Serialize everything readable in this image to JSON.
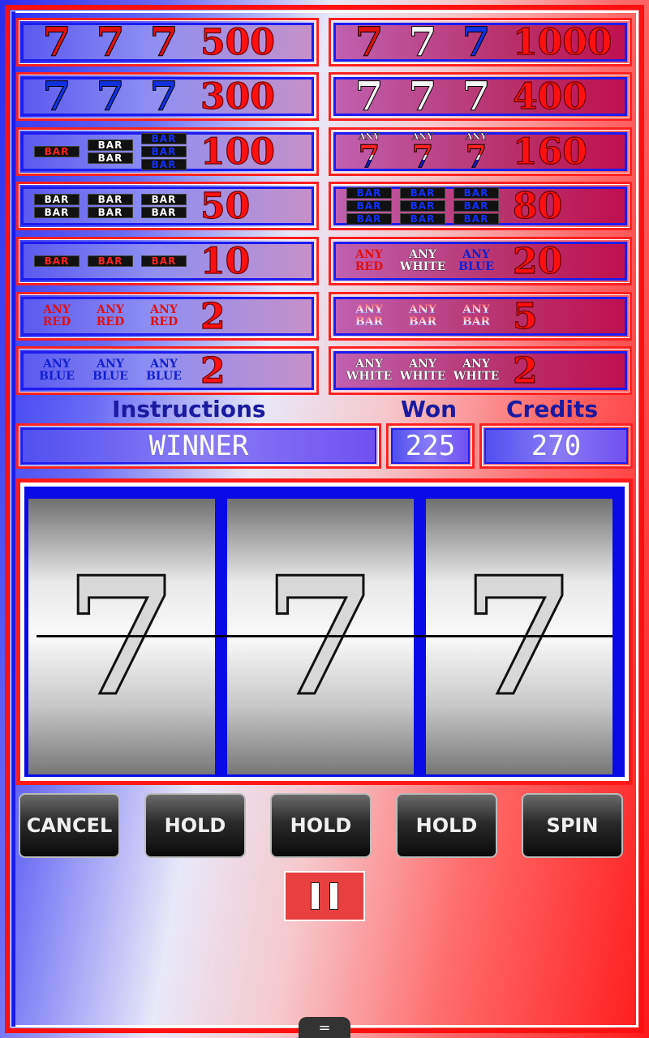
{
  "paytable": {
    "left": [
      {
        "symbols": [
          "seven-red",
          "seven-red",
          "seven-red"
        ],
        "payout": "500"
      },
      {
        "symbols": [
          "seven-blue",
          "seven-blue",
          "seven-blue"
        ],
        "payout": "300"
      },
      {
        "symbols": [
          "bar1-red",
          "bar2-white",
          "bar3-blue"
        ],
        "payout": "100"
      },
      {
        "symbols": [
          "bar2-white",
          "bar2-white",
          "bar2-white"
        ],
        "payout": "50"
      },
      {
        "symbols": [
          "bar1-red",
          "bar1-red",
          "bar1-red"
        ],
        "payout": "10"
      },
      {
        "symbols": [
          "any-red",
          "any-red",
          "any-red"
        ],
        "payout": "2"
      },
      {
        "symbols": [
          "any-blue",
          "any-blue",
          "any-blue"
        ],
        "payout": "2"
      }
    ],
    "right": [
      {
        "symbols": [
          "seven-red",
          "seven-white",
          "seven-blue"
        ],
        "payout": "1000"
      },
      {
        "symbols": [
          "seven-white",
          "seven-white",
          "seven-white"
        ],
        "payout": "400"
      },
      {
        "symbols": [
          "any-seven",
          "any-seven",
          "any-seven"
        ],
        "payout": "160"
      },
      {
        "symbols": [
          "bar3-blue",
          "bar3-blue",
          "bar3-blue"
        ],
        "payout": "80"
      },
      {
        "symbols": [
          "any-red",
          "any-white",
          "any-blue"
        ],
        "payout": "20"
      },
      {
        "symbols": [
          "any-bar",
          "any-bar",
          "any-bar"
        ],
        "payout": "5"
      },
      {
        "symbols": [
          "any-white",
          "any-white",
          "any-white"
        ],
        "payout": "2"
      }
    ],
    "text": {
      "bar": "BAR",
      "any": "ANY",
      "red": "RED",
      "white": "WHITE",
      "blue": "BLUE",
      "seven": "7"
    }
  },
  "labels": {
    "instructions": "Instructions",
    "won": "Won",
    "credits": "Credits"
  },
  "displays": {
    "instructions": "WINNER",
    "won": "225",
    "credits": "270"
  },
  "reels": [
    "7",
    "7",
    "7"
  ],
  "buttons": {
    "cancel": "CANCEL",
    "hold1": "HOLD",
    "hold2": "HOLD",
    "hold3": "HOLD",
    "spin": "SPIN"
  },
  "colors": {
    "red": "#ff1010",
    "blue": "#1c1cf0"
  }
}
